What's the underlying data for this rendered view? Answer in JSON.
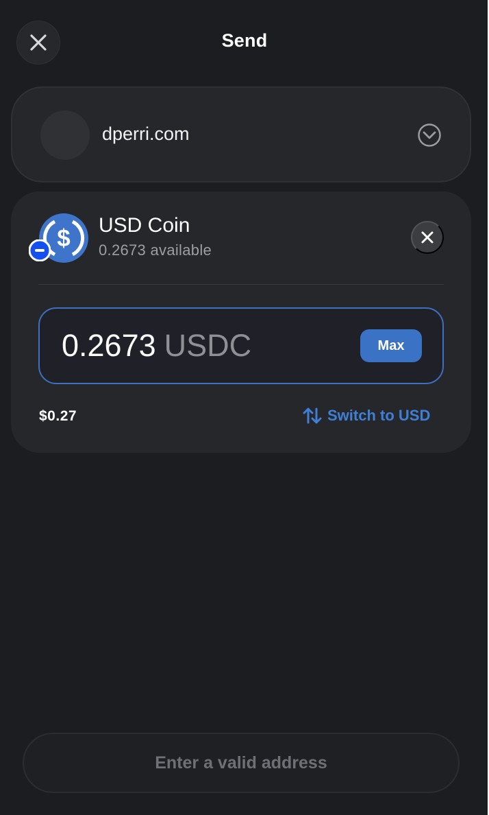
{
  "header": {
    "title": "Send"
  },
  "icons": {
    "close": "close-icon",
    "dropdown": "chevron-down-icon",
    "token": "usdc-icon",
    "network": "network-badge-icon",
    "clear": "close-icon",
    "switch": "swap-vertical-icon"
  },
  "recipient": {
    "name": "dperri.com"
  },
  "token": {
    "name": "USD Coin",
    "balance_text": "0.2673 available"
  },
  "amount": {
    "value": "0.2673",
    "unit": "USDC",
    "max_label": "Max",
    "fiat_value": "$0.27",
    "switch_label": "Switch to USD"
  },
  "footer": {
    "submit_label": "Enter a valid address"
  },
  "colors": {
    "background": "#1c1d20",
    "card": "#26272b",
    "accent": "#3a72c6",
    "link": "#3f7fd8"
  }
}
